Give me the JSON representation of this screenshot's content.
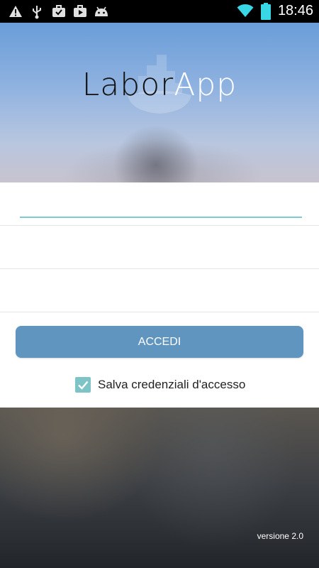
{
  "status_bar": {
    "time": "18:46",
    "icons": [
      "warning-icon",
      "usb-icon",
      "briefcase-check-icon",
      "briefcase-play-icon",
      "android-icon",
      "wifi-icon",
      "battery-icon"
    ]
  },
  "header": {
    "title_part1": "Labor",
    "title_part2": "App"
  },
  "form": {
    "username_placeholder": "",
    "password_placeholder": "",
    "server_placeholder": "",
    "login_label": "ACCEDI",
    "remember_label": "Salva credenziali d'accesso",
    "remember_checked": true
  },
  "footer": {
    "version": "versione 2.0"
  },
  "colors": {
    "accent": "#7fcbd0",
    "button": "#5f95bf",
    "checkbox": "#7ec3c6",
    "wifi": "#39d6e6",
    "battery": "#39d6e6"
  }
}
